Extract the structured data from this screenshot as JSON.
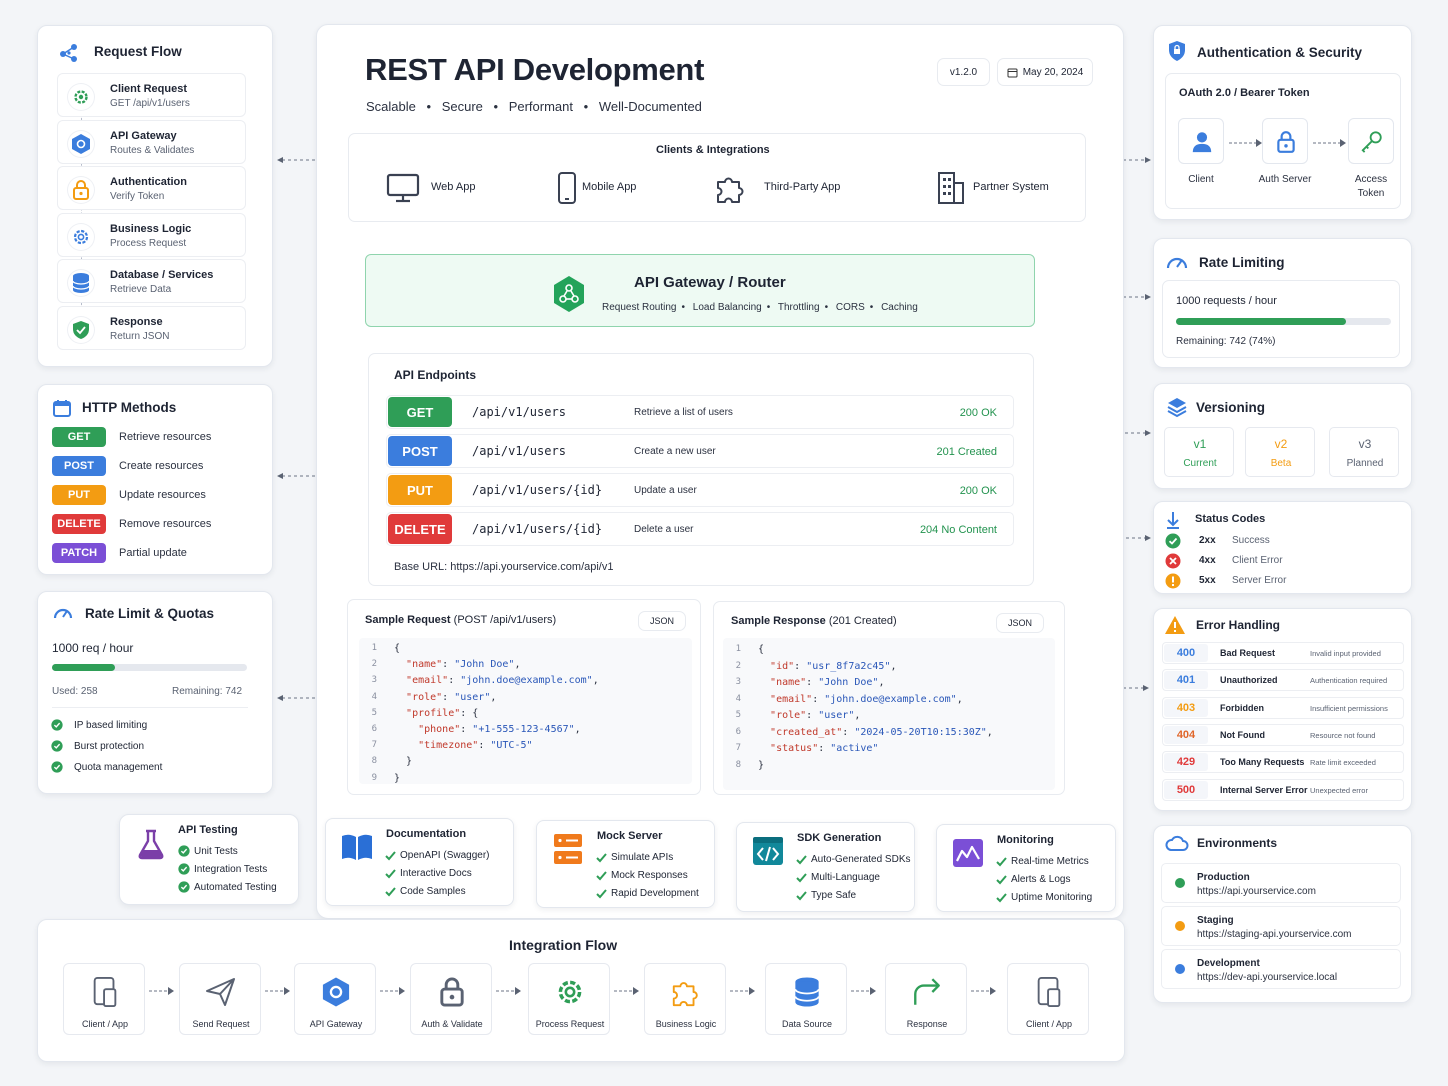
{
  "header": {
    "title": "REST API Development",
    "tagline": [
      "Scalable",
      "Secure",
      "Performant",
      "Well-Documented"
    ],
    "version": "v1.2.0",
    "date": "May 20, 2024"
  },
  "request_flow": {
    "title": "Request Flow",
    "steps": [
      {
        "title": "Client Request",
        "sub": "GET /api/v1/users",
        "icon": "gear-icon"
      },
      {
        "title": "API Gateway",
        "sub": "Routes & Validates",
        "icon": "hexagon-icon"
      },
      {
        "title": "Authentication",
        "sub": "Verify Token",
        "icon": "lock-icon"
      },
      {
        "title": "Business Logic",
        "sub": "Process Request",
        "icon": "cog-icon"
      },
      {
        "title": "Database / Services",
        "sub": "Retrieve Data",
        "icon": "database-icon"
      },
      {
        "title": "Response",
        "sub": "Return JSON",
        "icon": "shield-icon"
      }
    ]
  },
  "http_methods": {
    "title": "HTTP Methods",
    "items": [
      {
        "method": "GET",
        "desc": "Retrieve resources",
        "color": "#2f9e57"
      },
      {
        "method": "POST",
        "desc": "Create resources",
        "color": "#3b7ddd"
      },
      {
        "method": "PUT",
        "desc": "Update resources",
        "color": "#f39c12"
      },
      {
        "method": "DELETE",
        "desc": "Remove resources",
        "color": "#e03a3a"
      },
      {
        "method": "PATCH",
        "desc": "Partial update",
        "color": "#7b4fd6"
      }
    ]
  },
  "rate_quota": {
    "title": "Rate Limit & Quotas",
    "limit": "1000 req / hour",
    "used": "Used: 258",
    "remaining": "Remaining: 742",
    "fill_fraction": 0.258,
    "features": [
      "IP based limiting",
      "Burst protection",
      "Quota management"
    ]
  },
  "api_testing": {
    "title": "API Testing",
    "items": [
      "Unit Tests",
      "Integration Tests",
      "Automated Testing"
    ]
  },
  "clients": {
    "title": "Clients & Integrations",
    "items": [
      {
        "label": "Web App",
        "icon": "monitor-icon"
      },
      {
        "label": "Mobile App",
        "icon": "phone-icon"
      },
      {
        "label": "Third-Party App",
        "icon": "puzzle-icon"
      },
      {
        "label": "Partner System",
        "icon": "building-icon"
      }
    ]
  },
  "gateway": {
    "title": "API Gateway / Router",
    "features": [
      "Request Routing",
      "Load Balancing",
      "Throttling",
      "CORS",
      "Caching"
    ]
  },
  "endpoints": {
    "title": "API Endpoints",
    "rows": [
      {
        "method": "GET",
        "path": "/api/v1/users",
        "desc": "Retrieve a list of users",
        "status": "200 OK",
        "color": "#2f9e57"
      },
      {
        "method": "POST",
        "path": "/api/v1/users",
        "desc": "Create a new user",
        "status": "201 Created",
        "color": "#3b7ddd"
      },
      {
        "method": "PUT",
        "path": "/api/v1/users/{id}",
        "desc": "Update a user",
        "status": "200 OK",
        "color": "#f39c12"
      },
      {
        "method": "DELETE",
        "path": "/api/v1/users/{id}",
        "desc": "Delete a user",
        "status": "204 No Content",
        "color": "#e03a3a"
      }
    ],
    "base_url": "Base URL: https://api.yourservice.com/api/v1"
  },
  "sample_request": {
    "title": "Sample Request",
    "title_paren": "(POST /api/v1/users)",
    "tag": "JSON",
    "lines": [
      [
        [
          "p",
          "{"
        ]
      ],
      [
        [
          "p",
          "  "
        ],
        [
          "k",
          "\"name\""
        ],
        [
          "p",
          ": "
        ],
        [
          "s",
          "\"John Doe\""
        ],
        [
          "p",
          ","
        ]
      ],
      [
        [
          "p",
          "  "
        ],
        [
          "k",
          "\"email\""
        ],
        [
          "p",
          ": "
        ],
        [
          "s",
          "\"john.doe@example.com\""
        ],
        [
          "p",
          ","
        ]
      ],
      [
        [
          "p",
          "  "
        ],
        [
          "k",
          "\"role\""
        ],
        [
          "p",
          ": "
        ],
        [
          "s",
          "\"user\""
        ],
        [
          "p",
          ","
        ]
      ],
      [
        [
          "p",
          "  "
        ],
        [
          "k",
          "\"profile\""
        ],
        [
          "p",
          ": {"
        ]
      ],
      [
        [
          "p",
          "    "
        ],
        [
          "k",
          "\"phone\""
        ],
        [
          "p",
          ": "
        ],
        [
          "s",
          "\"+1-555-123-4567\""
        ],
        [
          "p",
          ","
        ]
      ],
      [
        [
          "p",
          "    "
        ],
        [
          "k",
          "\"timezone\""
        ],
        [
          "p",
          ": "
        ],
        [
          "s",
          "\"UTC-5\""
        ]
      ],
      [
        [
          "p",
          "  }"
        ]
      ],
      [
        [
          "p",
          "}"
        ]
      ]
    ]
  },
  "sample_response": {
    "title": "Sample Response",
    "title_paren": "(201 Created)",
    "tag": "JSON",
    "lines": [
      [
        [
          "p",
          "{"
        ]
      ],
      [
        [
          "p",
          "  "
        ],
        [
          "k",
          "\"id\""
        ],
        [
          "p",
          ": "
        ],
        [
          "s",
          "\"usr_8f7a2c45\""
        ],
        [
          "p",
          ","
        ]
      ],
      [
        [
          "p",
          "  "
        ],
        [
          "k",
          "\"name\""
        ],
        [
          "p",
          ": "
        ],
        [
          "s",
          "\"John Doe\""
        ],
        [
          "p",
          ","
        ]
      ],
      [
        [
          "p",
          "  "
        ],
        [
          "k",
          "\"email\""
        ],
        [
          "p",
          ": "
        ],
        [
          "s",
          "\"john.doe@example.com\""
        ],
        [
          "p",
          ","
        ]
      ],
      [
        [
          "p",
          "  "
        ],
        [
          "k",
          "\"role\""
        ],
        [
          "p",
          ": "
        ],
        [
          "s",
          "\"user\""
        ],
        [
          "p",
          ","
        ]
      ],
      [
        [
          "p",
          "  "
        ],
        [
          "k",
          "\"created_at\""
        ],
        [
          "p",
          ": "
        ],
        [
          "s",
          "\"2024-05-20T10:15:30Z\""
        ],
        [
          "p",
          ","
        ]
      ],
      [
        [
          "p",
          "  "
        ],
        [
          "k",
          "\"status\""
        ],
        [
          "p",
          ": "
        ],
        [
          "s",
          "\"active\""
        ]
      ],
      [
        [
          "p",
          "}"
        ]
      ]
    ]
  },
  "tools": [
    {
      "title": "Documentation",
      "icon": "book-icon",
      "items": [
        "OpenAPI (Swagger)",
        "Interactive Docs",
        "Code Samples"
      ]
    },
    {
      "title": "Mock Server",
      "icon": "server-icon",
      "items": [
        "Simulate APIs",
        "Mock Responses",
        "Rapid Development"
      ]
    },
    {
      "title": "SDK Generation",
      "icon": "code-icon",
      "items": [
        "Auto-Generated SDKs",
        "Multi-Language",
        "Type Safe"
      ]
    },
    {
      "title": "Monitoring",
      "icon": "chart-icon",
      "items": [
        "Real-time Metrics",
        "Alerts & Logs",
        "Uptime Monitoring"
      ]
    }
  ],
  "integration_flow": {
    "title": "Integration Flow",
    "steps": [
      {
        "label": "Client / App",
        "icon": "device-icon"
      },
      {
        "label": "Send Request",
        "icon": "send-icon"
      },
      {
        "label": "API Gateway",
        "icon": "hexagon-icon"
      },
      {
        "label": "Auth & Validate",
        "icon": "lock-icon"
      },
      {
        "label": "Process Request",
        "icon": "cog-icon"
      },
      {
        "label": "Business Logic",
        "icon": "puzzle-icon"
      },
      {
        "label": "Data Source",
        "icon": "database-icon"
      },
      {
        "label": "Response",
        "icon": "reply-icon"
      },
      {
        "label": "Client / App",
        "icon": "device-icon"
      }
    ]
  },
  "auth": {
    "title": "Authentication & Security",
    "subtitle": "OAuth 2.0 / Bearer Token",
    "steps": [
      {
        "label": "Client",
        "icon": "user-icon"
      },
      {
        "label": "Auth Server",
        "icon": "lock-icon"
      },
      {
        "label": "Access\nToken",
        "icon": "key-icon"
      }
    ]
  },
  "rate_limiting": {
    "title": "Rate Limiting",
    "limit": "1000 requests / hour",
    "remaining": "Remaining: 742 (74%)",
    "fill_fraction": 0.74
  },
  "versioning": {
    "title": "Versioning",
    "items": [
      {
        "version": "v1",
        "status": "Current",
        "color": "#2f9e57"
      },
      {
        "version": "v2",
        "status": "Beta",
        "color": "#f39c12"
      },
      {
        "version": "v3",
        "status": "Planned",
        "color": "#5a6272"
      }
    ]
  },
  "status_codes": {
    "title": "Status Codes",
    "items": [
      {
        "code": "2xx",
        "desc": "Success",
        "color": "#2f9e57",
        "icon": "check-icon"
      },
      {
        "code": "4xx",
        "desc": "Client Error",
        "color": "#e03a3a",
        "icon": "x-icon"
      },
      {
        "code": "5xx",
        "desc": "Server Error",
        "color": "#f39c12",
        "icon": "alert-icon"
      }
    ]
  },
  "error_handling": {
    "title": "Error Handling",
    "rows": [
      {
        "code": "400",
        "name": "Bad Request",
        "desc": "Invalid input provided",
        "color": "#3b7ddd"
      },
      {
        "code": "401",
        "name": "Unauthorized",
        "desc": "Authentication required",
        "color": "#3b7ddd"
      },
      {
        "code": "403",
        "name": "Forbidden",
        "desc": "Insufficient permissions",
        "color": "#f39c12"
      },
      {
        "code": "404",
        "name": "Not Found",
        "desc": "Resource not found",
        "color": "#e0662a"
      },
      {
        "code": "429",
        "name": "Too Many Requests",
        "desc": "Rate limit exceeded",
        "color": "#e03a3a"
      },
      {
        "code": "500",
        "name": "Internal Server Error",
        "desc": "Unexpected error",
        "color": "#e03a3a"
      }
    ]
  },
  "environments": {
    "title": "Environments",
    "items": [
      {
        "name": "Production",
        "url": "https://api.yourservice.com",
        "color": "#2f9e57"
      },
      {
        "name": "Staging",
        "url": "https://staging-api.yourservice.com",
        "color": "#f39c12"
      },
      {
        "name": "Development",
        "url": "https://dev-api.yourservice.local",
        "color": "#3b7ddd"
      }
    ]
  }
}
